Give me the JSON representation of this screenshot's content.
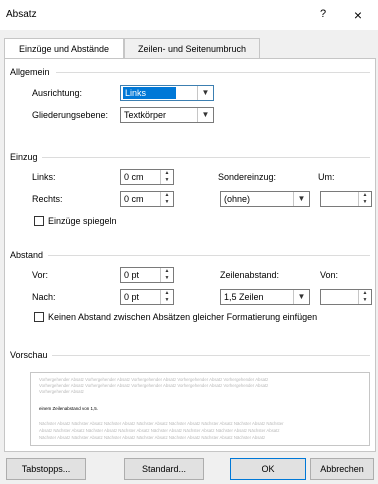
{
  "window": {
    "title": "Absatz",
    "help_label": "?",
    "close_label": "×"
  },
  "tabs": [
    {
      "label": "Einzüge und Abstände"
    },
    {
      "label": "Zeilen- und Seitenumbruch"
    }
  ],
  "allgemein": {
    "heading": "Allgemein",
    "ausrichtung_label": "Ausrichtung:",
    "ausrichtung_value": "Links",
    "gliederung_label": "Gliederungsebene:",
    "gliederung_value": "Textkörper"
  },
  "einzug": {
    "heading": "Einzug",
    "links_label": "Links:",
    "links_value": "0 cm",
    "rechts_label": "Rechts:",
    "rechts_value": "0 cm",
    "sonder_label": "Sondereinzug:",
    "sonder_value": "(ohne)",
    "um_label": "Um:",
    "um_value": "",
    "spiegeln_label": "Einzüge spiegeln"
  },
  "abstand": {
    "heading": "Abstand",
    "vor_label": "Vor:",
    "vor_value": "0 pt",
    "nach_label": "Nach:",
    "nach_value": "0 pt",
    "zeilen_label": "Zeilenabstand:",
    "zeilen_value": "1,5 Zeilen",
    "von_label": "Von:",
    "von_value": "",
    "keinen_label": "Keinen Abstand zwischen Absätzen gleicher Formatierung einfügen"
  },
  "vorschau": {
    "heading": "Vorschau",
    "prev_lines": [
      "Vorhergehender Absatz Vorhergehender Absatz Vorhergehender Absatz Vorhergehender Absatz Vorhergehender Absatz",
      "Vorhergehender Absatz Vorhergehender Absatz Vorhergehender Absatz Vorhergehender Absatz Vorhergehender Absatz",
      "Vorhergehender Absatz"
    ],
    "current_line": "einem Zeilenabstand von 1,5.",
    "next_lines": [
      "Nächster Absatz Nächster Absatz Nächster Absatz Nächster Absatz Nächster Absatz Nächster Absatz Nächster Absatz Nächster",
      "Absatz Nächster Absatz Nächster Absatz Nächster Absatz Nächster Absatz Nächster Absatz Nächster Absatz Nächster Absatz",
      "Nächster Absatz Nächster Absatz Nächster Absatz Nächster Absatz Nächster Absatz Nächster Absatz Nächster Absatz"
    ]
  },
  "buttons": {
    "tabstopps": "Tabstopps...",
    "standard": "Standard...",
    "ok": "OK",
    "abbrechen": "Abbrechen"
  },
  "colors": {
    "accent": "#0078d7",
    "border": "#c6c6c6",
    "background": "#f0f0f0"
  }
}
